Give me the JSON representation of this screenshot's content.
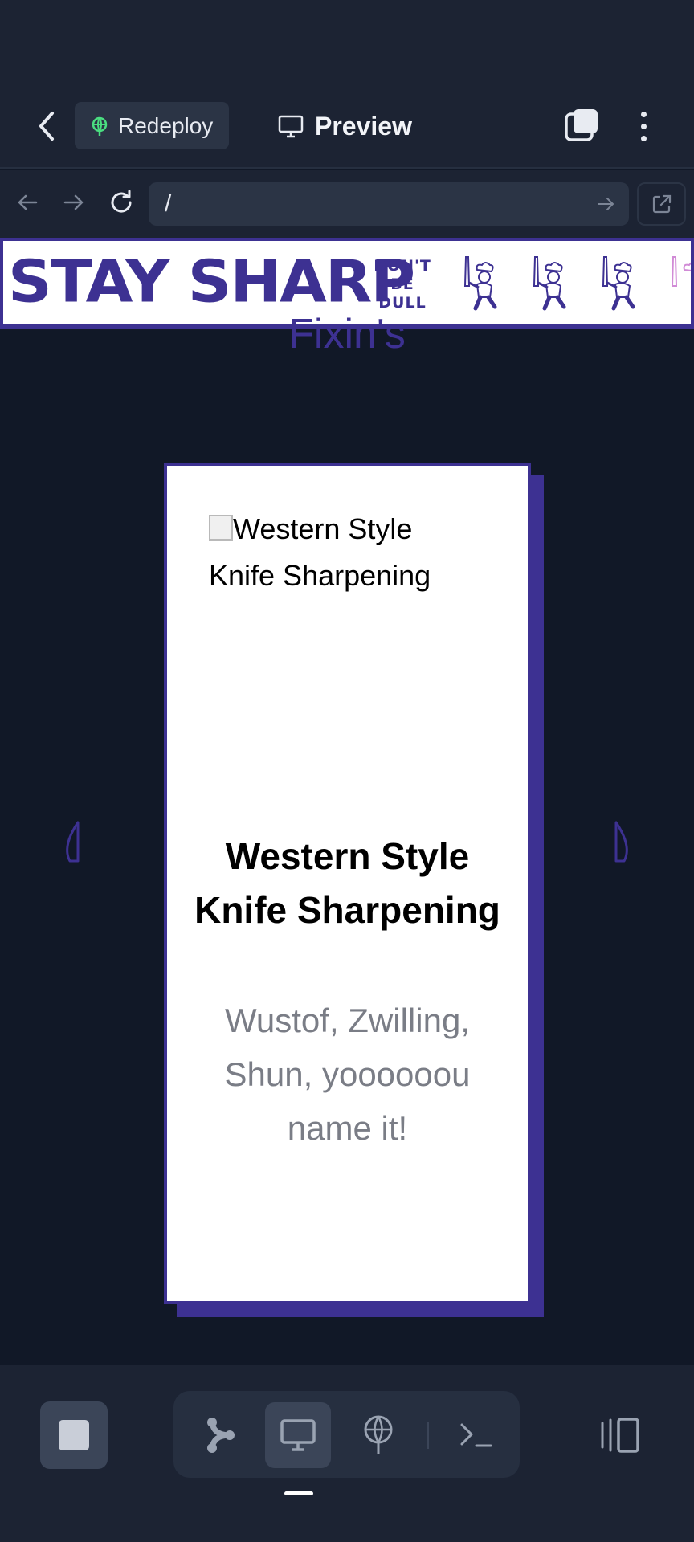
{
  "header": {
    "redeploy_label": "Redeploy",
    "title": "Preview"
  },
  "browser": {
    "url": "/"
  },
  "site": {
    "banner": {
      "title": "STAY SHARP",
      "subtitle_lines": [
        "DON'T",
        "BE",
        "DULL"
      ]
    },
    "title_partial": "Fixin's",
    "card": {
      "image_alt": "Western Style Knife Sharpening",
      "title": "Western Style Knife Sharpening",
      "description": "Wustof, Zwilling, Shun, yoooooou name it!"
    }
  },
  "colors": {
    "brand_purple": "#3d3192",
    "app_bg": "#111827",
    "chrome_bg": "#1c2333",
    "redeploy_icon": "#4ade80"
  },
  "icons": {
    "header": [
      "chevron-left-icon",
      "deploy-icon",
      "monitor-icon",
      "tabs-icon",
      "more-vertical-icon"
    ],
    "browser": [
      "arrow-left-icon",
      "arrow-right-icon",
      "refresh-icon",
      "arrow-right-icon",
      "external-link-icon"
    ],
    "bottom": [
      "stop-icon",
      "git-branch-icon",
      "monitor-icon",
      "deploy-icon",
      "terminal-icon",
      "layout-icon"
    ]
  }
}
